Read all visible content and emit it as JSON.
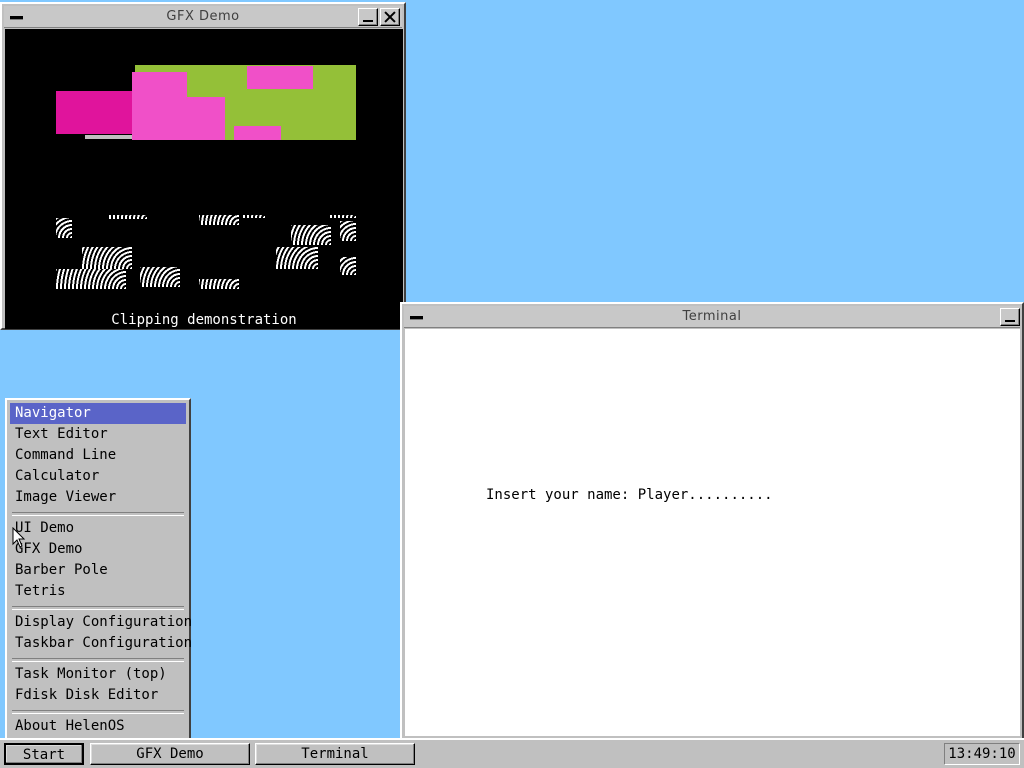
{
  "gfx_window": {
    "title": "GFX Demo",
    "caption": "Clipping demonstration"
  },
  "terminal_window": {
    "title": "Terminal",
    "prompt_label": "Insert your name:",
    "input_value": "Player.........."
  },
  "start_menu": {
    "groups": [
      [
        "Navigator",
        "Text Editor",
        "Command Line",
        "Calculator",
        "Image Viewer"
      ],
      [
        "UI Demo",
        "GFX Demo",
        "Barber Pole",
        "Tetris"
      ],
      [
        "Display Configuration",
        "Taskbar Configuration"
      ],
      [
        "Task Monitor (top)",
        "Fdisk Disk Editor"
      ],
      [
        "About HelenOS"
      ]
    ],
    "selected": "Navigator"
  },
  "taskbar": {
    "start_label": "Start",
    "tasks": [
      "GFX Demo",
      "Terminal"
    ],
    "clock": "13:49:10"
  },
  "colors": {
    "desktop": "#80c8ff",
    "menu_highlight": "#5a64c8",
    "green": "#94c038",
    "magenta": "#e0149c",
    "pink": "#f050c8"
  }
}
